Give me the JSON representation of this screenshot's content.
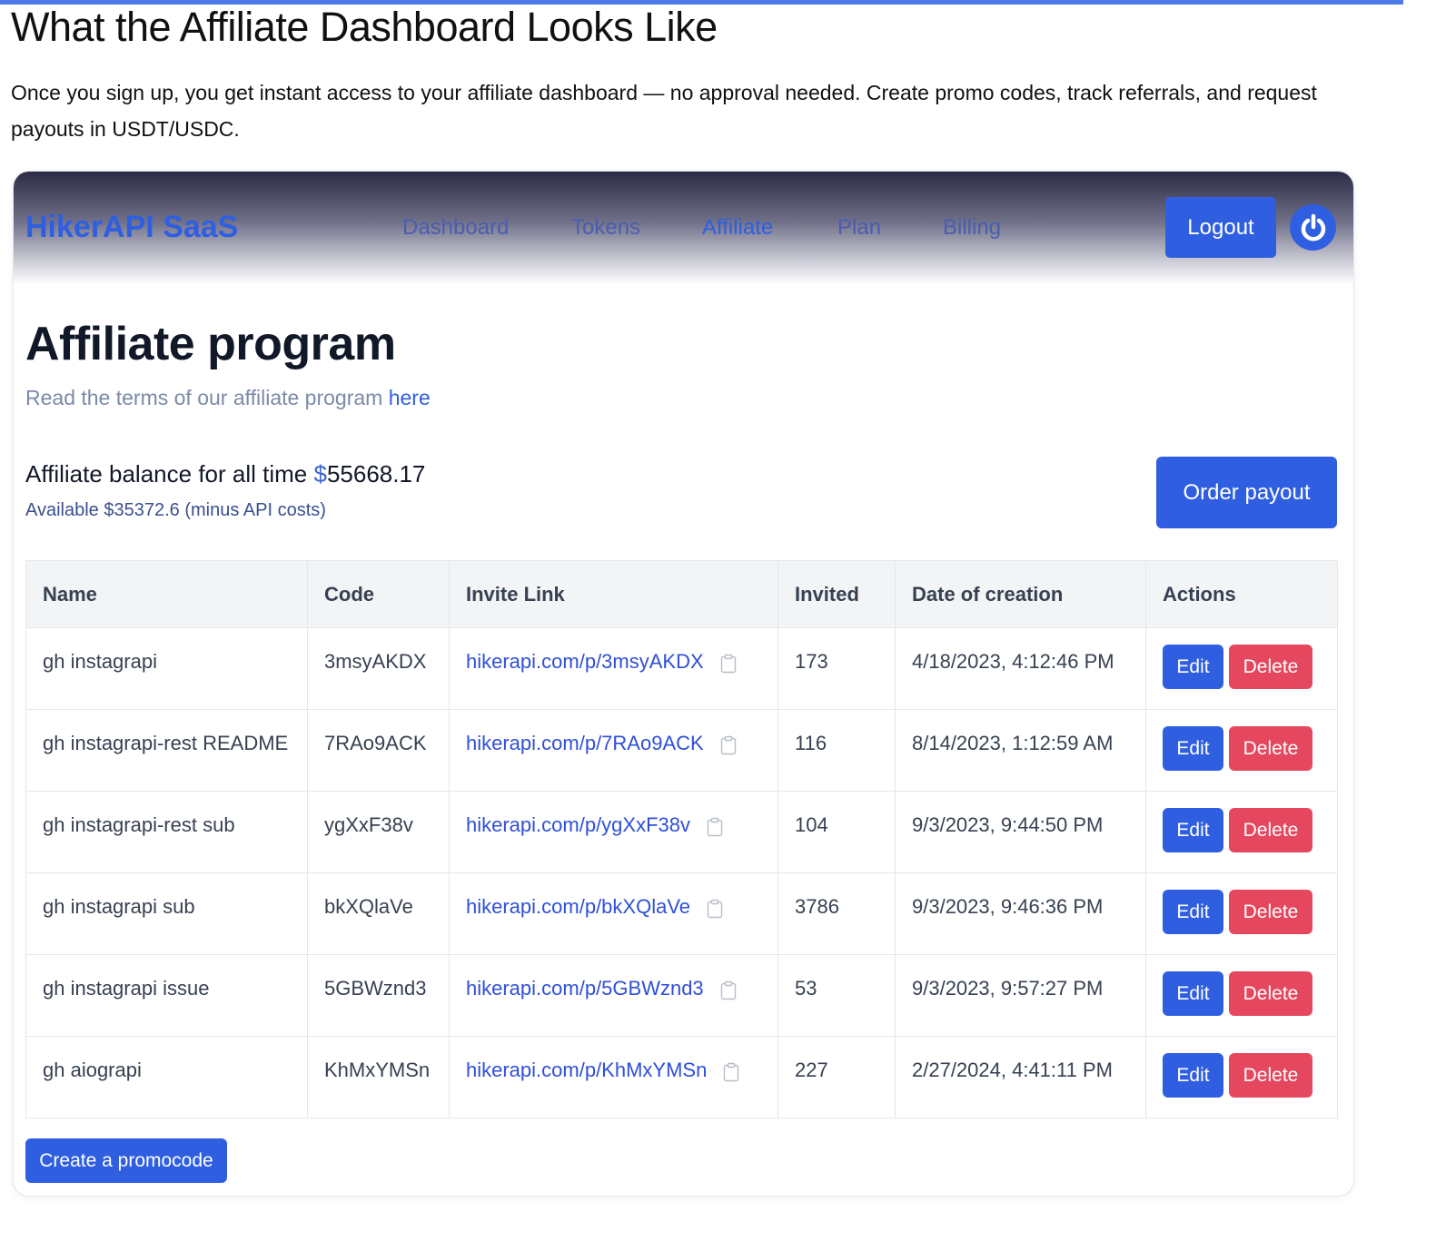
{
  "page": {
    "heading": "What the Affiliate Dashboard Looks Like",
    "intro": "Once you sign up, you get instant access to your affiliate dashboard — no approval needed. Create promo codes, track referrals, and request payouts in USDT/USDC."
  },
  "navbar": {
    "brand": "HikerAPI SaaS",
    "items": [
      "Dashboard",
      "Tokens",
      "Affiliate",
      "Plan",
      "Billing"
    ],
    "active_item": "Affiliate",
    "logout_label": "Logout",
    "power_icon": "power-icon"
  },
  "content": {
    "title": "Affiliate program",
    "terms_text": "Read the terms of our affiliate program",
    "terms_link": "here",
    "balance_label": "Affiliate balance for all time",
    "balance_currency": "$",
    "balance_value": "55668.17",
    "available_text": "Available $35372.6 (minus API costs)",
    "order_payout_label": "Order payout",
    "create_promocode_label": "Create a promocode"
  },
  "table": {
    "headers": [
      "Name",
      "Code",
      "Invite Link",
      "Invited",
      "Date of creation",
      "Actions"
    ],
    "edit_label": "Edit",
    "delete_label": "Delete",
    "rows": [
      {
        "name": "gh instagrapi",
        "code": "3msyAKDX",
        "link": "hikerapi.com/p/3msyAKDX",
        "invited": "173",
        "date": "4/18/2023, 4:12:46 PM"
      },
      {
        "name": "gh instagrapi-rest README",
        "code": "7RAo9ACK",
        "link": "hikerapi.com/p/7RAo9ACK",
        "invited": "116",
        "date": "8/14/2023, 1:12:59 AM"
      },
      {
        "name": "gh instagrapi-rest sub",
        "code": "ygXxF38v",
        "link": "hikerapi.com/p/ygXxF38v",
        "invited": "104",
        "date": "9/3/2023, 9:44:50 PM"
      },
      {
        "name": "gh instagrapi sub",
        "code": "bkXQlaVe",
        "link": "hikerapi.com/p/bkXQlaVe",
        "invited": "3786",
        "date": "9/3/2023, 9:46:36 PM"
      },
      {
        "name": "gh instagrapi issue",
        "code": "5GBWznd3",
        "link": "hikerapi.com/p/5GBWznd3",
        "invited": "53",
        "date": "9/3/2023, 9:57:27 PM"
      },
      {
        "name": "gh aiograpi",
        "code": "KhMxYMSn",
        "link": "hikerapi.com/p/KhMxYMSn",
        "invited": "227",
        "date": "2/27/2024, 4:41:11 PM"
      }
    ]
  },
  "colors": {
    "primary": "#2f5fe0",
    "danger": "#e5475e"
  }
}
